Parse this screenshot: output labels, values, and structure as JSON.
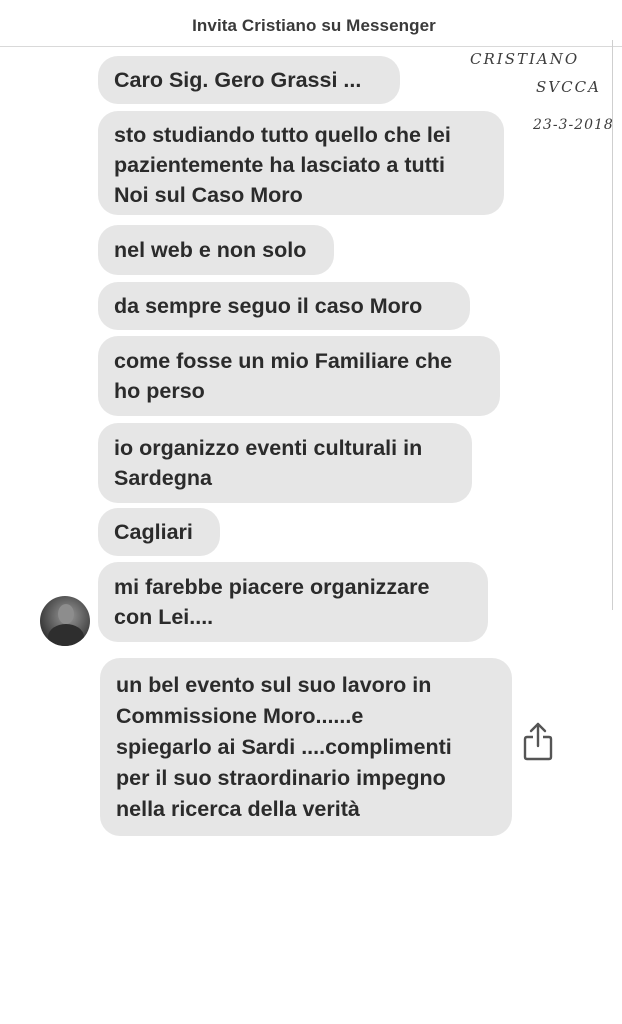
{
  "header": {
    "title": "Invita Cristiano su Messenger"
  },
  "annotation": {
    "name": "CRISTIANO",
    "surname": "SVCCA",
    "date": "23-3-2018"
  },
  "messages": [
    {
      "text": "Caro Sig. Gero Grassi ..."
    },
    {
      "text": "sto studiando tutto quello che lei\npazientemente ha lasciato a tutti\nNoi sul Caso Moro"
    },
    {
      "text": "nel web e non solo"
    },
    {
      "text": "da sempre seguo il caso Moro"
    },
    {
      "text": "come fosse un mio Familiare che\nho perso"
    },
    {
      "text": "io organizzo eventi culturali in\nSardegna"
    },
    {
      "text": "Cagliari"
    },
    {
      "text": "mi farebbe piacere organizzare\ncon Lei...."
    },
    {
      "text": "un bel evento sul suo lavoro in\nCommissione Moro......e\nspiegarlo ai Sardi ....complimenti\nper il suo straordinario impegno\nnella ricerca della verità"
    }
  ],
  "icons": {
    "avatar": "contact-avatar",
    "share": "share-icon"
  }
}
